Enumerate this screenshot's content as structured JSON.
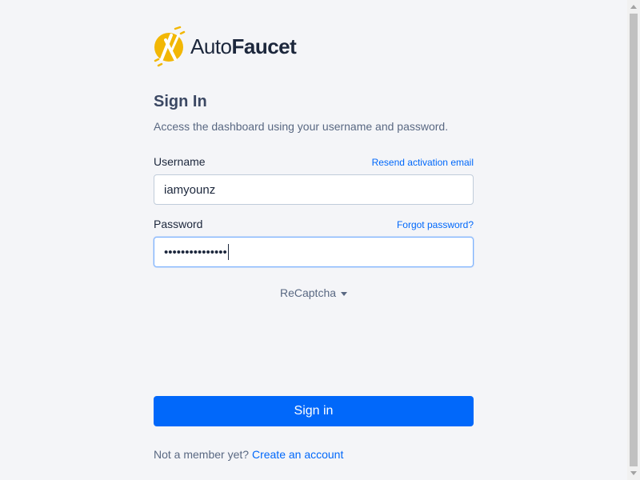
{
  "brand": {
    "name_light": "Auto",
    "name_bold": "Faucet",
    "accent": "#f2b705"
  },
  "form": {
    "title": "Sign In",
    "subtitle": "Access the dashboard using your username and password.",
    "username": {
      "label": "Username",
      "value": "iamyounz",
      "aux_link": "Resend activation email"
    },
    "password": {
      "label": "Password",
      "masked_value": "•••••••••••••••",
      "aux_link": "Forgot password?"
    },
    "captcha_label": "ReCaptcha",
    "submit_label": "Sign in",
    "footer": {
      "prompt": "Not a member yet?",
      "link": "Create an account"
    }
  },
  "colors": {
    "primary": "#0168fa",
    "background": "#f4f5f8",
    "heading": "#3b4863",
    "muted": "#596882"
  }
}
